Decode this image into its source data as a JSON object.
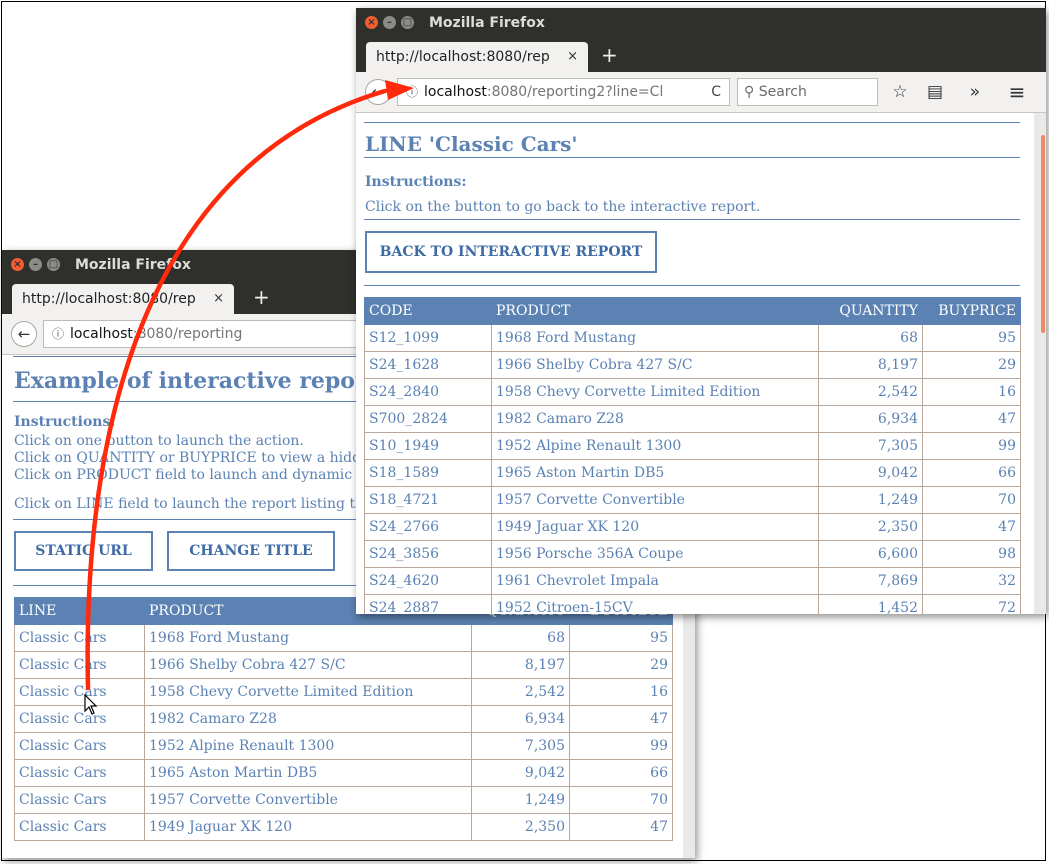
{
  "bottom_window": {
    "title": "Mozilla Firefox",
    "tab_title": "http://localhost:8080/rep",
    "tab_close": "×",
    "new_tab": "+",
    "back": "←",
    "info": "ⓘ",
    "url_host": "localhost",
    "url_path": ":8080/reporting",
    "page_title": "Example of interactive report",
    "instructions_label": "Instructions:",
    "instructions": [
      "Click on one button to launch the action.",
      "Click on QUANTITY or BUYPRICE to view a hidden field.",
      "Click on PRODUCT field to launch and dynamic link.",
      "Click on LINE field to launch the report listing the products."
    ],
    "buttons": {
      "static_url": "STATIC URL",
      "change_title": "CHANGE TITLE"
    },
    "columns": [
      "LINE",
      "PRODUCT",
      "QUANTITY",
      "BUYPRICE"
    ],
    "rows": [
      [
        "Classic Cars",
        "1968 Ford Mustang",
        "68",
        "95"
      ],
      [
        "Classic Cars",
        "1966 Shelby Cobra 427 S/C",
        "8,197",
        "29"
      ],
      [
        "Classic Cars",
        "1958 Chevy Corvette Limited Edition",
        "2,542",
        "16"
      ],
      [
        "Classic Cars",
        "1982 Camaro Z28",
        "6,934",
        "47"
      ],
      [
        "Classic Cars",
        "1952 Alpine Renault 1300",
        "7,305",
        "99"
      ],
      [
        "Classic Cars",
        "1965 Aston Martin DB5",
        "9,042",
        "66"
      ],
      [
        "Classic Cars",
        "1957 Corvette Convertible",
        "1,249",
        "70"
      ],
      [
        "Classic Cars",
        "1949 Jaguar XK 120",
        "2,350",
        "47"
      ]
    ]
  },
  "top_window": {
    "title": "Mozilla Firefox",
    "tab_title": "http://localhost:8080/rep",
    "tab_close": "×",
    "new_tab": "+",
    "back": "←",
    "info": "ⓘ",
    "url_host": "localhost",
    "url_path": ":8080/reporting2?line=Cl",
    "reload": "C",
    "search_placeholder": "Search",
    "bookmark_icon": "☆",
    "library_icon": "▤",
    "overflow_icon": "»",
    "menu_icon": "≡",
    "page_title": "LINE 'Classic Cars'",
    "instructions_label": "Instructions:",
    "instructions": "Click on the button to go back to the interactive report.",
    "back_button": "BACK TO INTERACTIVE REPORT",
    "columns": [
      "CODE",
      "PRODUCT",
      "QUANTITY",
      "BUYPRICE"
    ],
    "rows": [
      [
        "S12_1099",
        "1968 Ford Mustang",
        "68",
        "95"
      ],
      [
        "S24_1628",
        "1966 Shelby Cobra 427 S/C",
        "8,197",
        "29"
      ],
      [
        "S24_2840",
        "1958 Chevy Corvette Limited Edition",
        "2,542",
        "16"
      ],
      [
        "S700_2824",
        "1982 Camaro Z28",
        "6,934",
        "47"
      ],
      [
        "S10_1949",
        "1952 Alpine Renault 1300",
        "7,305",
        "99"
      ],
      [
        "S18_1589",
        "1965 Aston Martin DB5",
        "9,042",
        "66"
      ],
      [
        "S18_4721",
        "1957 Corvette Convertible",
        "1,249",
        "70"
      ],
      [
        "S24_2766",
        "1949 Jaguar XK 120",
        "2,350",
        "47"
      ],
      [
        "S24_3856",
        "1956 Porsche 356A Coupe",
        "6,600",
        "98"
      ],
      [
        "S24_4620",
        "1961 Chevrolet Impala",
        "7,869",
        "32"
      ],
      [
        "S24_2887",
        "1952 Citroen-15CV",
        "1,452",
        "72"
      ]
    ]
  },
  "annotation": {
    "arrow_color": "#ff2a0c"
  },
  "colors": {
    "accent": "#5b82b3",
    "border": "#bba79a",
    "titlebar": "#2f2f2c"
  }
}
